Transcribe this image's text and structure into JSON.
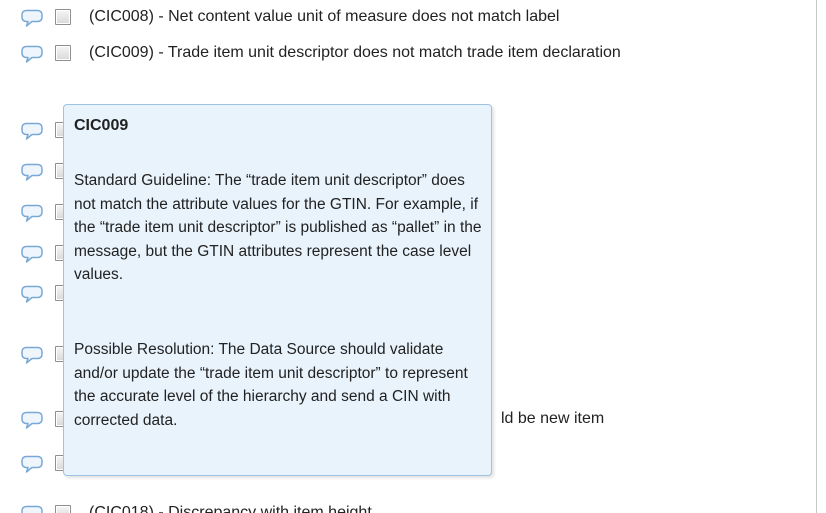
{
  "rows": [
    {
      "text": "(CIC008) - Net content value unit of measure does not match label"
    },
    {
      "text": "(CIC009) - Trade item unit descriptor does not match trade item declaration"
    },
    {
      "text": ""
    },
    {
      "text": ""
    },
    {
      "text": ""
    },
    {
      "text": ""
    },
    {
      "text": ""
    },
    {
      "text": ""
    },
    {
      "text": "ld be new item"
    },
    {
      "text": ""
    },
    {
      "text": "(CIC018) - Discrepancy with item height"
    }
  ],
  "tooltip": {
    "title": "CIC009",
    "guideline": "Standard Guideline: The “trade item unit descriptor” does not match the attribute values for the GTIN. For example, if the “trade item unit descriptor” is published as “pallet” in the message, but the GTIN attributes represent the case level values.",
    "resolution": "Possible Resolution: The Data Source should validate and/or update the “trade item unit descriptor” to represent the accurate level of the hierarchy and send a CIN with corrected data."
  },
  "colors": {
    "tooltip_bg": "#e8f3fc",
    "tooltip_border": "#9fc2e3",
    "comment_icon": "#7aa8d6"
  },
  "icons": {
    "comment": "speech-bubble-icon",
    "checkbox": "checkbox"
  }
}
